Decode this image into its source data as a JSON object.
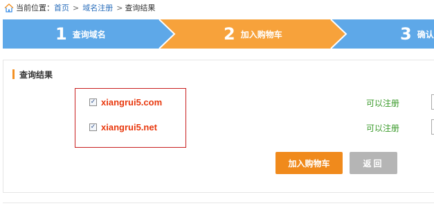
{
  "breadcrumb": {
    "icon": "home-icon",
    "prefix": "当前位置：",
    "home": "首页",
    "sep1": ">",
    "domain_reg": "域名注册",
    "sep2": ">",
    "current": "查询结果"
  },
  "steps": [
    {
      "num": "1",
      "label": "查询域名",
      "color": "#5ea8e8"
    },
    {
      "num": "2",
      "label": "加入购物车",
      "color": "#f7a23b"
    },
    {
      "num": "3",
      "label": "确认",
      "color": "#5ea8e8"
    }
  ],
  "panel": {
    "title": "查询结果",
    "rows": [
      {
        "checked": "✓",
        "domain": "xiangrui5.com",
        "status": "可以注册"
      },
      {
        "checked": "✓",
        "domain": "xiangrui5.net",
        "status": "可以注册"
      }
    ]
  },
  "buttons": {
    "add_to_cart": "加入购物车",
    "back": "返回"
  },
  "colors": {
    "accent": "#f39124",
    "step_blue": "#5ea8e8",
    "step_orange": "#f7a23b",
    "domain_text": "#e8370c",
    "available": "#3a9a2a",
    "highlight_border": "#c81e1e"
  }
}
